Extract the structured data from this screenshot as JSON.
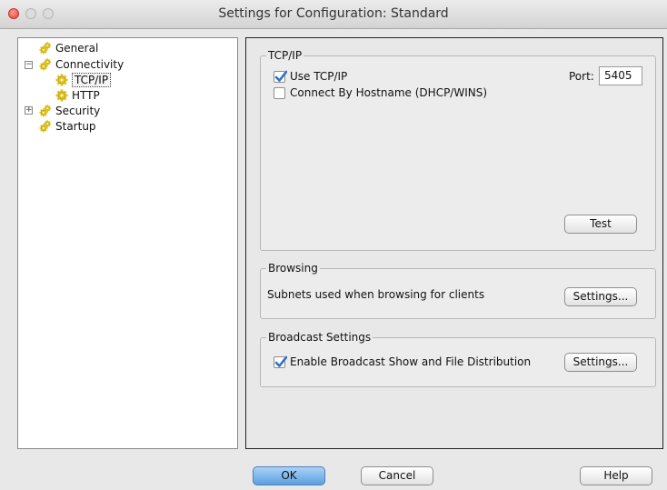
{
  "window": {
    "title": "Settings for Configuration: Standard"
  },
  "tree": {
    "items": [
      {
        "label": "General"
      },
      {
        "label": "Connectivity",
        "expanded": true
      },
      {
        "label": "TCP/IP",
        "selected": true
      },
      {
        "label": "HTTP"
      },
      {
        "label": "Security",
        "expanded": false
      },
      {
        "label": "Startup"
      }
    ]
  },
  "tcpip": {
    "legend": "TCP/IP",
    "use_tcpip": {
      "label": "Use TCP/IP",
      "checked": true
    },
    "connect_by_hostname": {
      "label": "Connect By Hostname (DHCP/WINS)",
      "checked": false
    },
    "port_label": "Port:",
    "port_value": "5405",
    "test_button": "Test"
  },
  "browsing": {
    "legend": "Browsing",
    "description": "Subnets used when browsing for clients",
    "settings_button": "Settings..."
  },
  "broadcast": {
    "legend": "Broadcast Settings",
    "enable": {
      "label": "Enable Broadcast Show and File Distribution",
      "checked": true
    },
    "settings_button": "Settings..."
  },
  "footer": {
    "ok": "OK",
    "cancel": "Cancel",
    "help": "Help"
  },
  "colors": {
    "accent": "#5d9fe0",
    "check": "#2f6fc9",
    "gear": "#e0c21e"
  }
}
